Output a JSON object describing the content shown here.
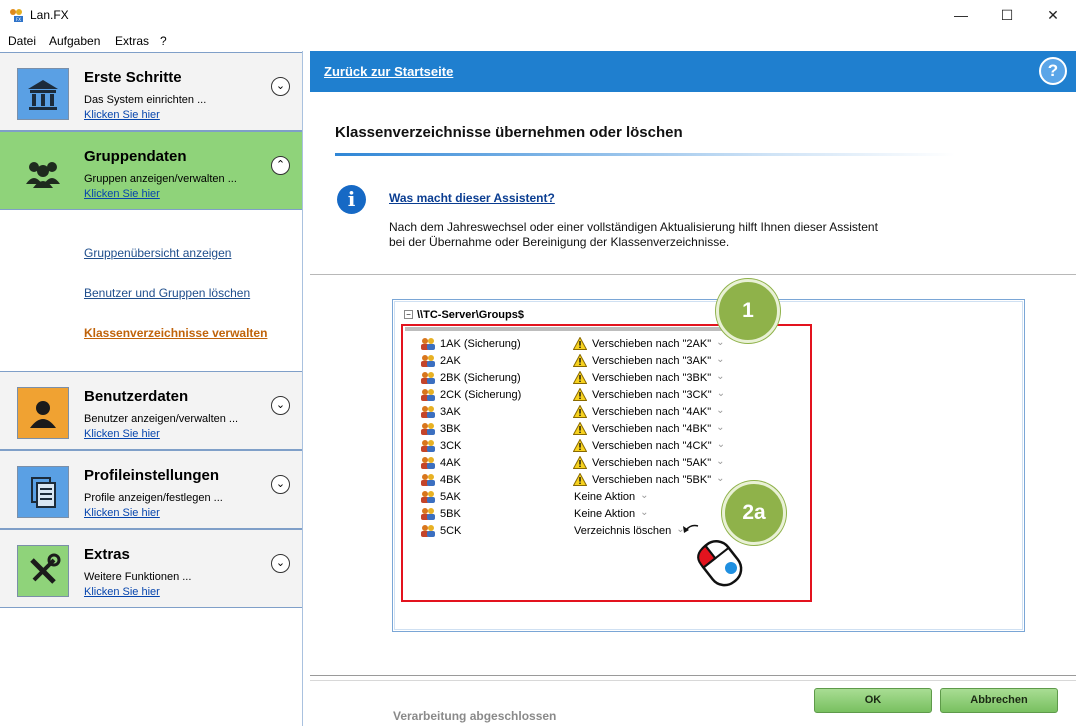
{
  "window": {
    "title": "Lan.FX"
  },
  "menu": [
    "Datei",
    "Aufgaben",
    "Extras",
    "?"
  ],
  "sidebar": {
    "panels": [
      {
        "title": "Erste Schritte",
        "subtitle": "Das System einrichten ...",
        "link": "Klicken Sie hier",
        "icon": "bank-icon",
        "expanded": false
      },
      {
        "title": "Gruppendaten",
        "subtitle": "Gruppen anzeigen/verwalten ...",
        "link": "Klicken Sie hier",
        "icon": "group-icon",
        "expanded": true
      },
      {
        "title": "Benutzerdaten",
        "subtitle": "Benutzer anzeigen/verwalten ...",
        "link": "Klicken Sie hier",
        "icon": "user-icon",
        "expanded": false
      },
      {
        "title": "Profileinstellungen",
        "subtitle": "Profile anzeigen/festlegen ...",
        "link": "Klicken Sie hier",
        "icon": "profile-icon",
        "expanded": false
      },
      {
        "title": "Extras",
        "subtitle": "Weitere Funktionen ...",
        "link": "Klicken Sie hier",
        "icon": "tools-icon",
        "expanded": false
      }
    ],
    "group_links": [
      "Gruppenübersicht anzeigen",
      "Benutzer und Gruppen löschen",
      "Klassenverzeichnisse verwalten"
    ]
  },
  "header": {
    "back_link": "Zurück zur Startseite",
    "help": "?"
  },
  "main": {
    "title": "Klassenverzeichnisse übernehmen oder löschen",
    "info_link": "Was macht dieser Assistent?",
    "description_line1": "Nach dem Jahreswechsel oder einer vollständigen Aktualisierung hilft Ihnen dieser Assistent",
    "description_line2": "bei der Übernahme oder Bereinigung der Klassenverzeichnisse."
  },
  "tree": {
    "root": "\\\\TC-Server\\Groups$",
    "rows": [
      {
        "name": "1AK (Sicherung)",
        "warning": true,
        "action": "Verschieben nach \"2AK\""
      },
      {
        "name": "2AK",
        "warning": true,
        "action": "Verschieben nach \"3AK\""
      },
      {
        "name": "2BK (Sicherung)",
        "warning": true,
        "action": "Verschieben nach \"3BK\""
      },
      {
        "name": "2CK (Sicherung)",
        "warning": true,
        "action": "Verschieben nach \"3CK\""
      },
      {
        "name": "3AK",
        "warning": true,
        "action": "Verschieben nach \"4AK\""
      },
      {
        "name": "3BK",
        "warning": true,
        "action": "Verschieben nach \"4BK\""
      },
      {
        "name": "3CK",
        "warning": true,
        "action": "Verschieben nach \"4CK\""
      },
      {
        "name": "4AK",
        "warning": true,
        "action": "Verschieben nach \"5AK\""
      },
      {
        "name": "4BK",
        "warning": true,
        "action": "Verschieben nach \"5BK\""
      },
      {
        "name": "5AK",
        "warning": false,
        "action": "Keine Aktion"
      },
      {
        "name": "5BK",
        "warning": false,
        "action": "Keine Aktion"
      },
      {
        "name": "5CK",
        "warning": false,
        "action": "Verzeichnis löschen"
      }
    ]
  },
  "annotations": {
    "badge1": "1",
    "badge2": "2a"
  },
  "footer": {
    "status": "Verarbeitung abgeschlossen",
    "ok": "OK",
    "cancel": "Abbrechen"
  },
  "colors": {
    "accent": "#1f7fcf",
    "active_panel": "#8fd37a",
    "annotation_box": "#e3131e",
    "badge": "#8fb24a"
  }
}
